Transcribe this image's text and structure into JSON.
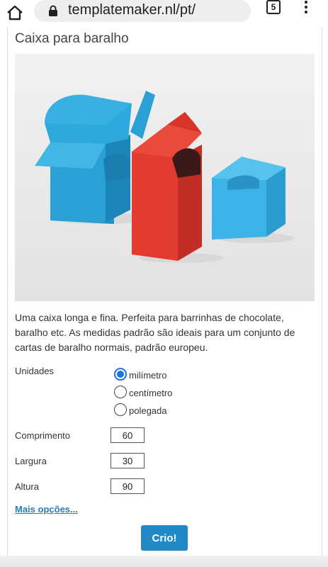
{
  "browser": {
    "url": "templatemaker.nl/pt/",
    "tab_count": "5",
    "icons": [
      "home-icon",
      "lock-icon",
      "tabs-icon",
      "kebab-menu-icon"
    ]
  },
  "page": {
    "title": "Caixa para baralho",
    "image_icon": "boxes-photo",
    "description": "Uma caixa longa e fina. Perfeita para barrinhas de chocolate, baralho etc. As medidas padrão são ideais para um conjunto de cartas de baralho normais, padrão europeu."
  },
  "form": {
    "units_label": "Unidades",
    "units_options": [
      {
        "label": "milímetro",
        "checked": true
      },
      {
        "label": "centímetro",
        "checked": false
      },
      {
        "label": "polegada",
        "checked": false
      }
    ],
    "length_label": "Comprimento",
    "length_value": "60",
    "width_label": "Largura",
    "width_value": "30",
    "height_label": "Altura",
    "height_value": "90",
    "more_options": "Mais opções...",
    "submit_label": "Crio!"
  },
  "colors": {
    "accent": "#1a73e8",
    "button": "#1f8ac6",
    "link": "#1f7fbf",
    "box_blue": "#2aa0d4",
    "box_red": "#e23b30",
    "box_light_blue": "#3cb3e6"
  }
}
